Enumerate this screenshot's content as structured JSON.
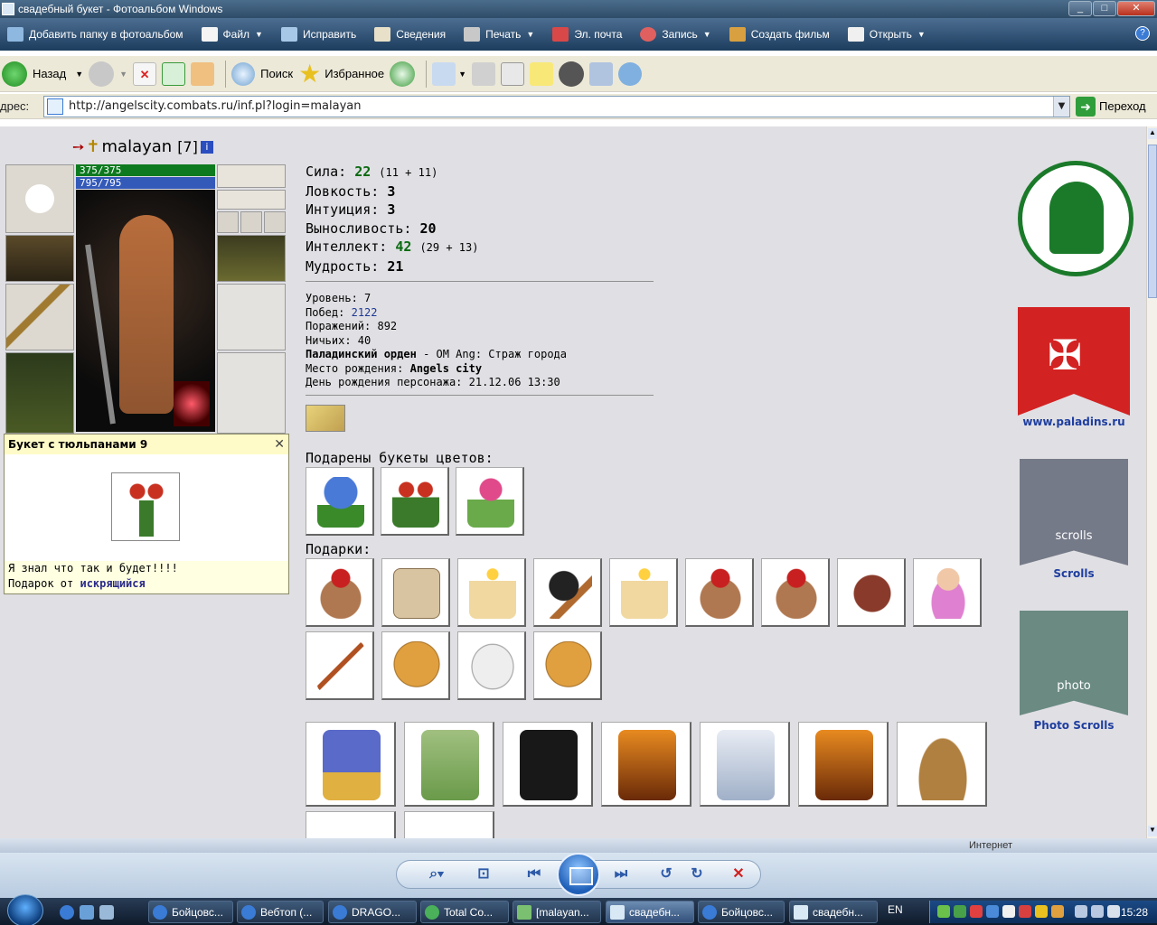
{
  "window": {
    "title": "свадебный букет - Фотоальбом Windows",
    "buttons": [
      "_",
      "□",
      "✕"
    ]
  },
  "command_bar": {
    "items": [
      {
        "label": "Добавить папку в фотоальбом",
        "icon": "add-folder-icon",
        "dropdown": false
      },
      {
        "label": "Файл",
        "icon": "file-icon",
        "dropdown": true
      },
      {
        "label": "Исправить",
        "icon": "fix-icon",
        "dropdown": false
      },
      {
        "label": "Сведения",
        "icon": "info-icon",
        "dropdown": false
      },
      {
        "label": "Печать",
        "icon": "print-icon",
        "dropdown": true
      },
      {
        "label": "Эл. почта",
        "icon": "email-icon",
        "dropdown": false
      },
      {
        "label": "Запись",
        "icon": "burn-icon",
        "dropdown": true
      },
      {
        "label": "Создать фильм",
        "icon": "movie-icon",
        "dropdown": false
      },
      {
        "label": "Открыть",
        "icon": "open-icon",
        "dropdown": true
      }
    ],
    "help": "?"
  },
  "browser": {
    "back_label": "Назад",
    "search_label": "Поиск",
    "favorites_label": "Избранное",
    "address_label": "Адрес:",
    "address_label_visible": "дрес:",
    "url": "http://angelscity.combats.ru/inf.pl?login=malayan",
    "go_label": "Переход"
  },
  "character": {
    "name": "malayan",
    "level": "[7]",
    "hp": "375/375",
    "mana": "795/795",
    "stats": [
      {
        "label": "Сила:",
        "value": "22",
        "extra": "(11 + 11)",
        "green": true
      },
      {
        "label": "Ловкость:",
        "value": "3",
        "extra": "",
        "green": false
      },
      {
        "label": "Интуиция:",
        "value": "3",
        "extra": "",
        "green": false
      },
      {
        "label": "Выносливость:",
        "value": "20",
        "extra": "",
        "green": false
      },
      {
        "label": "Интеллект:",
        "value": "42",
        "extra": "(29 + 13)",
        "green": true
      },
      {
        "label": "Мудрость:",
        "value": "21",
        "extra": "",
        "green": false
      }
    ],
    "level_line": "Уровень: 7",
    "wins_label": "Побед:",
    "wins": "2122",
    "losses": "Поражений: 892",
    "draws": "Ничьих: 40",
    "order_bold": "Паладинский орден",
    "order_rest": "- ОМ Ang: Страж города",
    "birthplace_label": "Место рождения:",
    "birthplace": "Angels city",
    "birthday": "День рождения персонажа: 21.12.06 13:30"
  },
  "popup": {
    "title": "Букет с тюльпанами 9",
    "message": "Я знал что так и будет!!!!",
    "from_label": "Подарок от",
    "from": "искрящийся"
  },
  "bouquets_label": "Подарены букеты цветов:",
  "gifts_label": "Подарки:",
  "bouquets": [
    "blue-flower-bouquet",
    "tulip-bouquet",
    "pink-flower-bouquet"
  ],
  "gifts": [
    "teddy-bear-santa-hat",
    "parchment-scroll",
    "candle",
    "spiked-mace",
    "candle",
    "teddy-bear-santa-hat",
    "teddy-bear-santa-hat",
    "lantern-ornament",
    "baby-doll",
    "broom",
    "gold-medal-4",
    "hockey-mask",
    "gold-medal-4"
  ],
  "big_gifts": [
    "gift-boxes-ribbon",
    "wrapped-presents",
    "black-gift-bag",
    "fire-poster",
    "silver-package",
    "fire-poster",
    "easter-basket"
  ],
  "logos": {
    "paladins": "www.paladins.ru",
    "scrolls": "Scrolls",
    "scrolls_text": "scrolls",
    "photo": "Photo Scrolls",
    "photo_text": "photo"
  },
  "statusbar": {
    "zone": "Интернет"
  },
  "taskbar": {
    "buttons": [
      {
        "label": "Бойцовс...",
        "active": false
      },
      {
        "label": "Вебтоп (...",
        "active": false
      },
      {
        "label": "DRAGO...",
        "active": false
      },
      {
        "label": "Total Co...",
        "active": false
      },
      {
        "label": "[malayan...",
        "active": false
      },
      {
        "label": "свадебн...",
        "active": true
      },
      {
        "label": "Бойцовс...",
        "active": false
      },
      {
        "label": "свадебн...",
        "active": false
      }
    ],
    "language": "EN",
    "time": "15:28"
  },
  "colors": {
    "hp": "#0d7a1f",
    "mana": "#3359b9",
    "stat_green": "#086a10",
    "link_blue": "#1e3a96",
    "paladin_red": "#d32222",
    "clan_green": "#1a7a2a"
  }
}
